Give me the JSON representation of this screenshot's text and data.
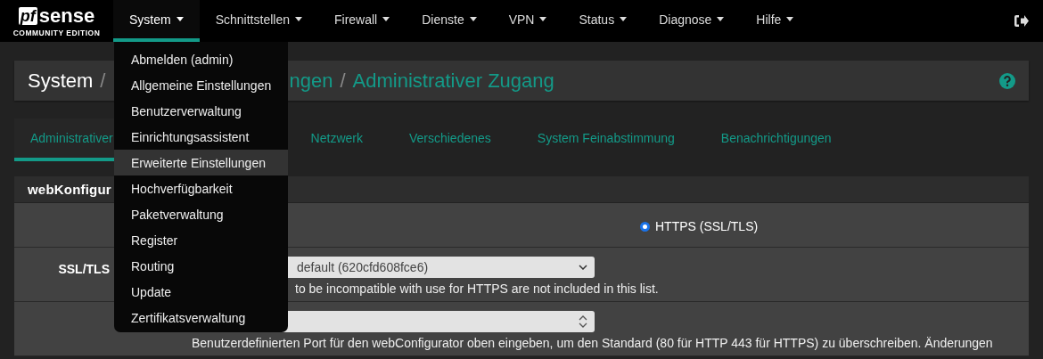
{
  "brand": {
    "mark": "pf",
    "name": "sense",
    "edition": "COMMUNITY EDITION"
  },
  "nav": [
    {
      "label": "System",
      "selected": true
    },
    {
      "label": "Schnittstellen",
      "selected": false
    },
    {
      "label": "Firewall",
      "selected": false
    },
    {
      "label": "Dienste",
      "selected": false
    },
    {
      "label": "VPN",
      "selected": false
    },
    {
      "label": "Status",
      "selected": false
    },
    {
      "label": "Diagnose",
      "selected": false
    },
    {
      "label": "Hilfe",
      "selected": false
    }
  ],
  "menu": {
    "items": [
      {
        "label": "Abmelden (admin)",
        "selected": false
      },
      {
        "label": "Allgemeine Einstellungen",
        "selected": false
      },
      {
        "label": "Benutzerverwaltung",
        "selected": false
      },
      {
        "label": "Einrichtungsassistent",
        "selected": false
      },
      {
        "label": "Erweiterte Einstellungen",
        "selected": true
      },
      {
        "label": "Hochverfügbarkeit",
        "selected": false
      },
      {
        "label": "Paketverwaltung",
        "selected": false
      },
      {
        "label": "Register",
        "selected": false
      },
      {
        "label": "Routing",
        "selected": false
      },
      {
        "label": "Update",
        "selected": false
      },
      {
        "label": "Zertifikatsverwaltung",
        "selected": false
      }
    ]
  },
  "breadcrumb": {
    "items": [
      {
        "label": "System",
        "kind": "plain"
      },
      {
        "separator": "/",
        "kind": "separator"
      },
      {
        "label": "ngen",
        "kind": "link"
      },
      {
        "separator": "/",
        "kind": "separator"
      },
      {
        "label": "Administrativer Zugang",
        "kind": "link"
      }
    ]
  },
  "tabs": [
    {
      "label": "Administrativer",
      "selected": true
    },
    {
      "label": "Netzwerk",
      "selected": false
    },
    {
      "label": "Verschiedenes",
      "selected": false
    },
    {
      "label": "System Feinabstimmung",
      "selected": false
    },
    {
      "label": "Benachrichtigungen",
      "selected": false
    }
  ],
  "section": {
    "title": "webKonfigur",
    "rows": [
      {
        "kind": "radio",
        "options": [
          {
            "label": "HTTPS (SSL/TLS)",
            "selected": true
          }
        ]
      },
      {
        "label": "SSL/TLS",
        "kind": "select",
        "value": "default (620cfd608fce6)",
        "help": "to be incompatible with use for HTTPS are not included in this list."
      },
      {
        "kind": "number",
        "help": "Benutzerdefinierten Port für den webConfigurator oben eingeben, um den Standard (80 für HTTP 443 für HTTPS) zu überschreiben. Änderungen"
      }
    ]
  }
}
